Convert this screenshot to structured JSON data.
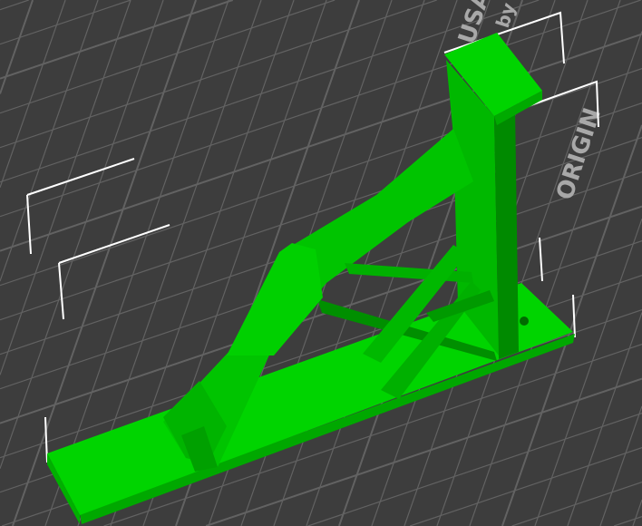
{
  "viewport": {
    "bed_texture_text": [
      "USA",
      "by",
      "ORIGIN"
    ],
    "model_color": "#00cc00",
    "model_shadow_color": "#008f00",
    "bed_color": "#3d3d3d",
    "grid_color": "#626262"
  }
}
